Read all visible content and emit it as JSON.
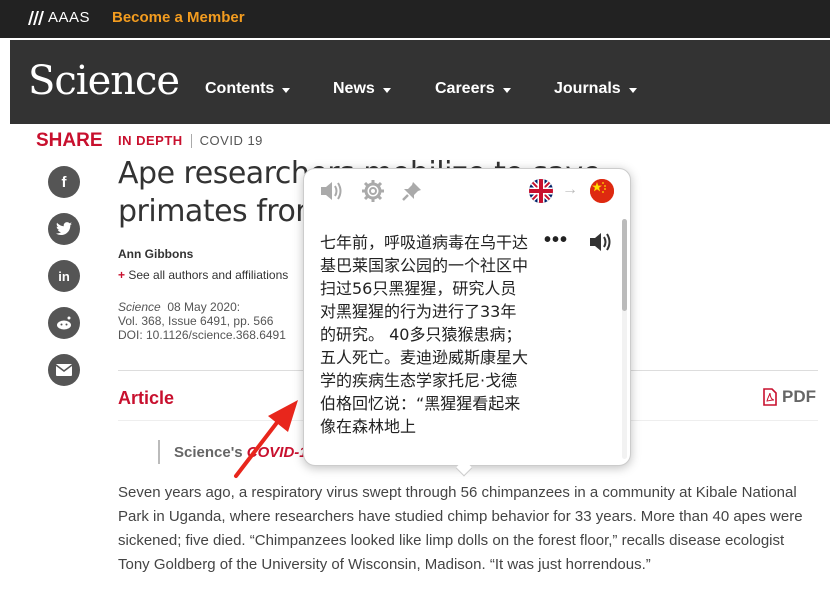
{
  "topbar": {
    "logo": "AAAS",
    "member": "Become a Member"
  },
  "nav": {
    "logo": "Science",
    "items": [
      {
        "label": "Contents"
      },
      {
        "label": "News"
      },
      {
        "label": "Careers"
      },
      {
        "label": "Journals"
      }
    ]
  },
  "share": {
    "label": "SHARE",
    "icons": [
      "facebook-icon",
      "twitter-icon",
      "linkedin-icon",
      "reddit-icon",
      "email-icon"
    ],
    "glyphs": {
      "facebook": "f",
      "linkedin": "in"
    }
  },
  "article": {
    "kicker": "IN DEPTH",
    "tag": "COVID 19",
    "title": "Ape researchers mobilize to save primates from coronavirus",
    "author": "Ann Gibbons",
    "see_all": "See all authors and affiliations",
    "journal": "Science",
    "date": "08 May 2020:",
    "volume": "Vol. 368, Issue 6491, pp. 566",
    "doi": "DOI: 10.1126/science.368.6491",
    "section_label": "Article",
    "pdf_label": "PDF",
    "series_prefix": "Science's",
    "series_italic": "COVID-1",
    "body": "Seven years ago, a respiratory virus swept through 56 chimpanzees in a community at Kibale National Park in Uganda, where researchers have studied chimp behavior for 33 years. More than 40 apes were sickened; five died. “Chimpanzees looked like limp dolls on the forest floor,” recalls disease ecologist Tony Goldberg of the University of Wisconsin, Madison. “It was just horrendous.”"
  },
  "popup": {
    "icons": [
      "speaker-icon",
      "gear-icon",
      "pin-icon"
    ],
    "source_lang": "uk-flag-icon",
    "target_lang": "china-flag-icon",
    "arrow": "→",
    "more": "•••",
    "translation": "七年前，呼吸道病毒在乌干达基巴莱国家公园的一个社区中扫过56只黑猩猩，研究人员对黑猩猩的行为进行了33年的研究。 40多只猿猴患病；五人死亡。麦迪逊威斯康星大学的疾病生态学家托尼·戈德伯格回忆说：“黑猩猩看起来像在森林地上"
  },
  "colors": {
    "brand_red": "#c8102e",
    "member_orange": "#f39c1f",
    "arrow_red": "#e8261c"
  }
}
